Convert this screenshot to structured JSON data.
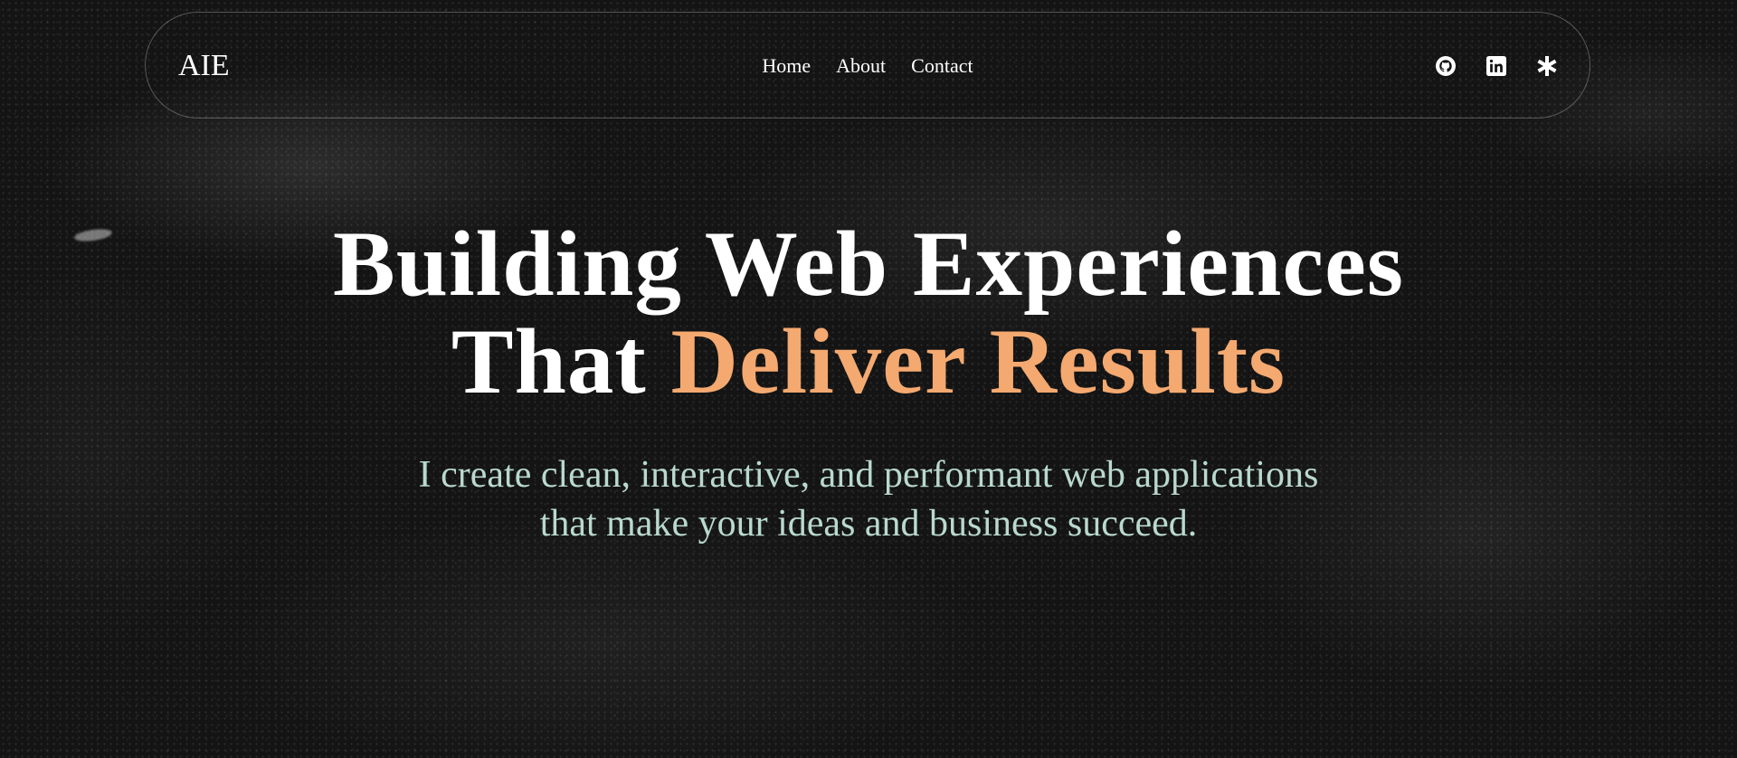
{
  "brand": {
    "logo_text": "AIE"
  },
  "nav": {
    "links": [
      {
        "label": "Home"
      },
      {
        "label": "About"
      },
      {
        "label": "Contact"
      }
    ]
  },
  "social": [
    {
      "icon": "github-icon"
    },
    {
      "icon": "linkedin-icon"
    },
    {
      "icon": "asterisk-icon"
    }
  ],
  "hero": {
    "headline_line1": "Building Web Experiences",
    "headline_line2_prefix": "That",
    "headline_line2_accent": "Deliver Results",
    "subtitle": "I create clean, interactive, and performant web applications that make your ideas and business succeed."
  },
  "colors": {
    "accent": "#f4a970",
    "subtitle": "#b9d9cf",
    "text": "#ffffff",
    "background": "#141414"
  }
}
